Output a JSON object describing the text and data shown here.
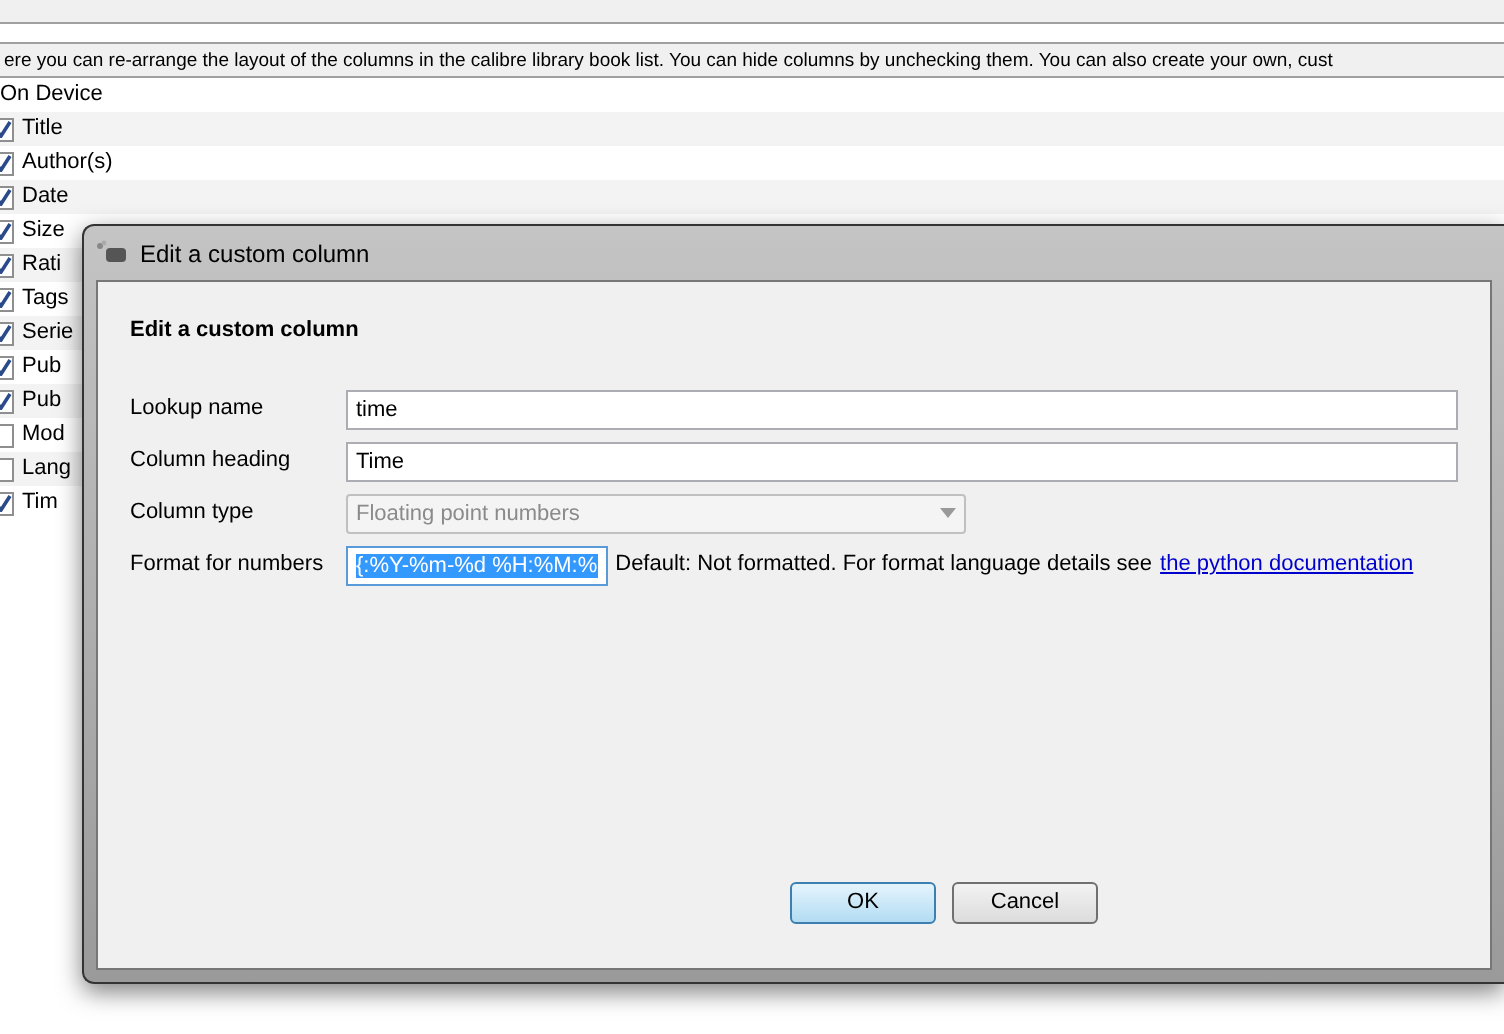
{
  "description": "ere you can re-arrange the layout of the columns in the calibre library book list. You can hide columns by unchecking them. You can also create your own, cust",
  "columns": [
    {
      "kind": "plain",
      "label": "On Device"
    },
    {
      "kind": "checkbox",
      "label": "Title",
      "checked": true
    },
    {
      "kind": "checkbox",
      "label": "Author(s)",
      "checked": true
    },
    {
      "kind": "checkbox",
      "label": "Date",
      "checked": true
    },
    {
      "kind": "checkbox",
      "label": "Size",
      "checked": true
    },
    {
      "kind": "checkbox",
      "label": "Rati",
      "checked": true
    },
    {
      "kind": "checkbox",
      "label": "Tags",
      "checked": true
    },
    {
      "kind": "checkbox",
      "label": "Serie",
      "checked": true
    },
    {
      "kind": "checkbox",
      "label": "Pub",
      "checked": true
    },
    {
      "kind": "checkbox",
      "label": "Pub",
      "checked": true
    },
    {
      "kind": "checkbox",
      "label": "Mod",
      "checked": false
    },
    {
      "kind": "checkbox",
      "label": "Lang",
      "checked": false
    },
    {
      "kind": "checkbox",
      "label": "Tim",
      "checked": true
    }
  ],
  "dialog": {
    "title": "Edit a custom column",
    "heading": "Edit a custom column",
    "fields": [
      {
        "kind": "text",
        "label": "Lookup name",
        "value": "time"
      },
      {
        "kind": "text",
        "label": "Column heading",
        "value": "Time"
      },
      {
        "kind": "select",
        "label": "Column type",
        "value": "Floating point numbers",
        "disabled": true
      },
      {
        "kind": "format",
        "label": "Format for numbers",
        "value": "{:%Y-%m-%d %H:%M:%",
        "selected": true,
        "help": "Default: Not formatted. For format language details see",
        "link": "the python documentation"
      }
    ],
    "buttons": [
      {
        "label": "OK",
        "default": true
      },
      {
        "label": "Cancel",
        "default": false
      }
    ]
  }
}
